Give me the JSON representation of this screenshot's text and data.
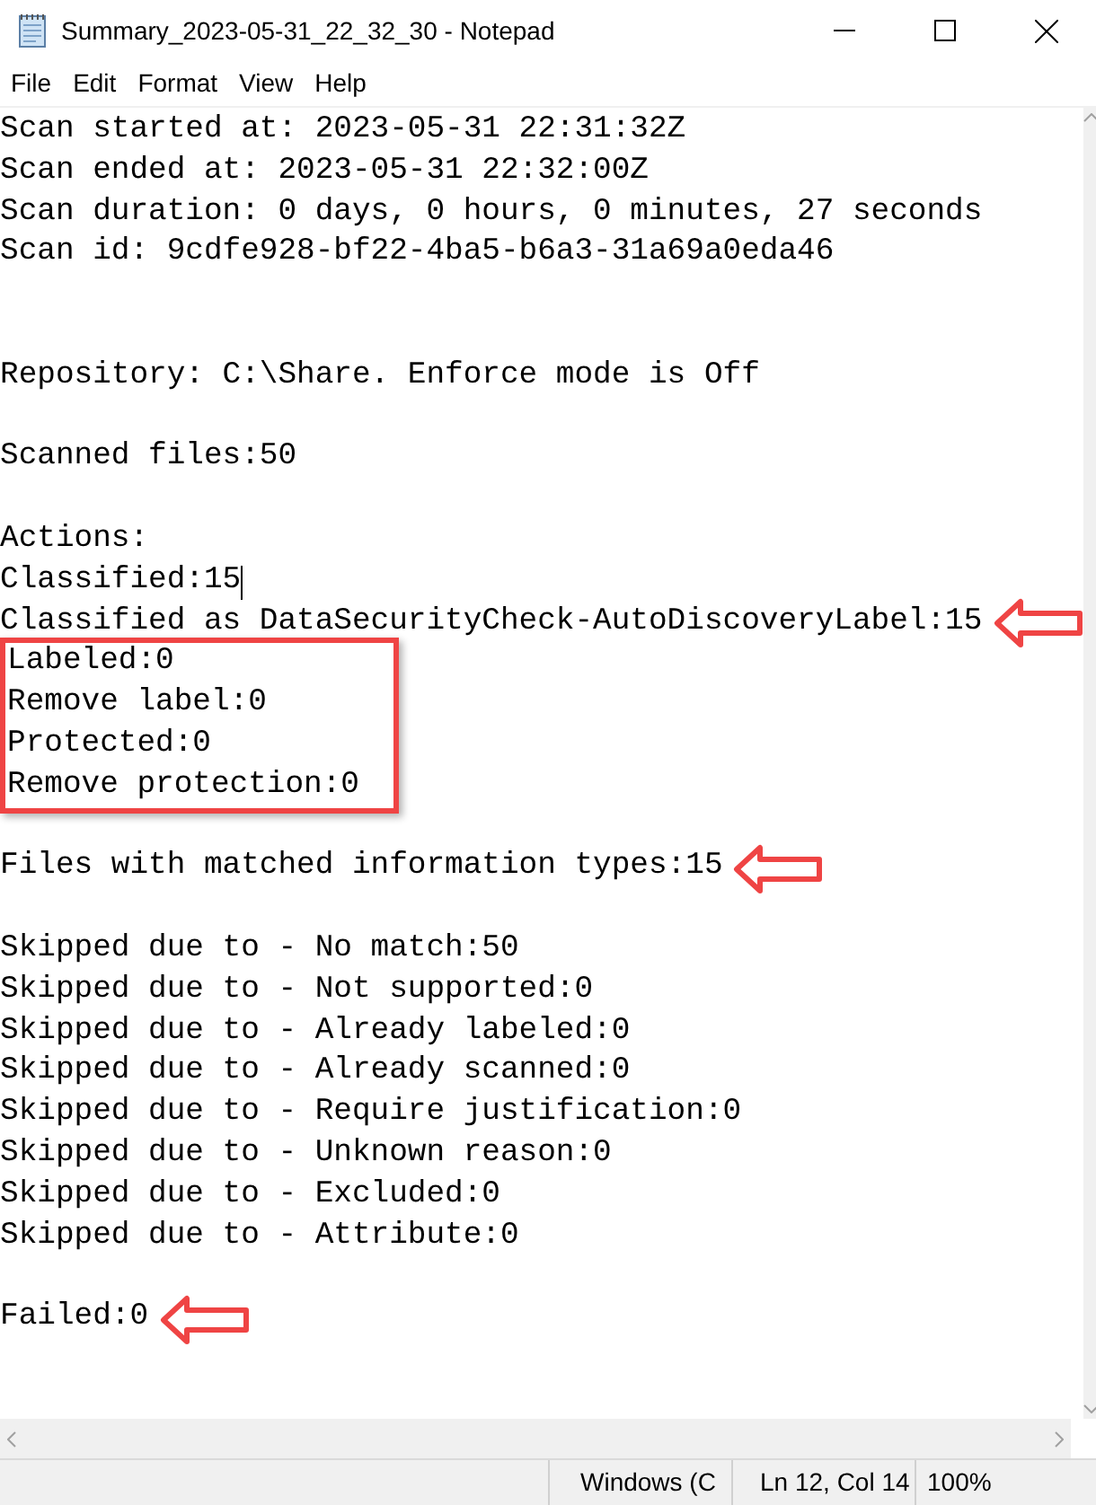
{
  "window": {
    "title": "Summary_2023-05-31_22_32_30 - Notepad"
  },
  "menu": [
    "File",
    "Edit",
    "Format",
    "View",
    "Help"
  ],
  "lines": [
    {
      "kind": "text",
      "text": "Scan started at: 2023-05-31 22:31:32Z"
    },
    {
      "kind": "text",
      "text": "Scan ended at: 2023-05-31 22:32:00Z"
    },
    {
      "kind": "text",
      "text": "Scan duration: 0 days, 0 hours, 0 minutes, 27 seconds"
    },
    {
      "kind": "text",
      "text": "Scan id: 9cdfe928-bf22-4ba5-b6a3-31a69a0eda46"
    },
    {
      "kind": "blank"
    },
    {
      "kind": "blank"
    },
    {
      "kind": "text",
      "text": "Repository: C:\\Share. Enforce mode is Off"
    },
    {
      "kind": "blank"
    },
    {
      "kind": "text",
      "text": "Scanned files:50"
    },
    {
      "kind": "blank"
    },
    {
      "kind": "text",
      "text": "Actions:"
    },
    {
      "kind": "text",
      "text": "Classified:15",
      "caret": true
    },
    {
      "kind": "text",
      "text": "Classified as DataSecurityCheck-AutoDiscoveryLabel:15",
      "arrow": true
    },
    {
      "kind": "boxed",
      "lines": [
        {
          "kind": "text",
          "text": "Labeled:0"
        },
        {
          "kind": "text",
          "text": "Remove label:0"
        },
        {
          "kind": "text",
          "text": "Protected:0"
        },
        {
          "kind": "text",
          "text": "Remove protection:0"
        }
      ]
    },
    {
      "kind": "blank"
    },
    {
      "kind": "text",
      "text": "Files with matched information types:15",
      "arrow": true
    },
    {
      "kind": "blank"
    },
    {
      "kind": "text",
      "text": "Skipped due to - No match:50"
    },
    {
      "kind": "text",
      "text": "Skipped due to - Not supported:0"
    },
    {
      "kind": "text",
      "text": "Skipped due to - Already labeled:0"
    },
    {
      "kind": "text",
      "text": "Skipped due to - Already scanned:0"
    },
    {
      "kind": "text",
      "text": "Skipped due to - Require justification:0"
    },
    {
      "kind": "text",
      "text": "Skipped due to - Unknown reason:0"
    },
    {
      "kind": "text",
      "text": "Skipped due to - Excluded:0"
    },
    {
      "kind": "text",
      "text": "Skipped due to - Attribute:0"
    },
    {
      "kind": "blank"
    },
    {
      "kind": "text",
      "text": "Failed:0",
      "arrow": true
    }
  ],
  "status_bar": {
    "encoding": "Windows (C",
    "position": "Ln 12, Col 14",
    "zoom": "100%"
  }
}
